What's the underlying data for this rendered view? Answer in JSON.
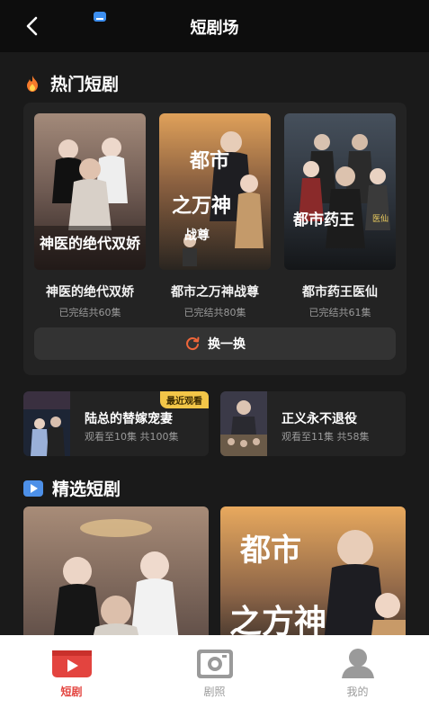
{
  "header": {
    "title": "短剧场"
  },
  "hot": {
    "heading": "热门短剧",
    "items": [
      {
        "title": "神医的绝代双娇",
        "meta": "已完结共60集",
        "poster_text": "神医的绝代双娇"
      },
      {
        "title": "都市之万神战尊",
        "meta": "已完结共80集",
        "poster_text": "都市之万神战尊"
      },
      {
        "title": "都市药王医仙",
        "meta": "已完结共61集",
        "poster_text": "都市药王医仙"
      }
    ],
    "swap_label": "换一换"
  },
  "recent": [
    {
      "title": "陆总的替嫁宠妻",
      "meta": "观看至10集 共100集",
      "badge": "最近观看"
    },
    {
      "title": "正义永不退役",
      "meta": "观看至11集 共58集"
    }
  ],
  "featured": {
    "heading": "精选短剧",
    "items": [
      {
        "poster_text": ""
      },
      {
        "poster_text": "都市之万神"
      }
    ]
  },
  "tabs": [
    {
      "label": "短剧",
      "icon": "play-video-icon",
      "active": true
    },
    {
      "label": "剧照",
      "icon": "camera-icon",
      "active": false
    },
    {
      "label": "我的",
      "icon": "user-icon",
      "active": false
    }
  ],
  "colors": {
    "accent": "#e3443f",
    "badge": "#f3c648",
    "panel": "#232323"
  }
}
